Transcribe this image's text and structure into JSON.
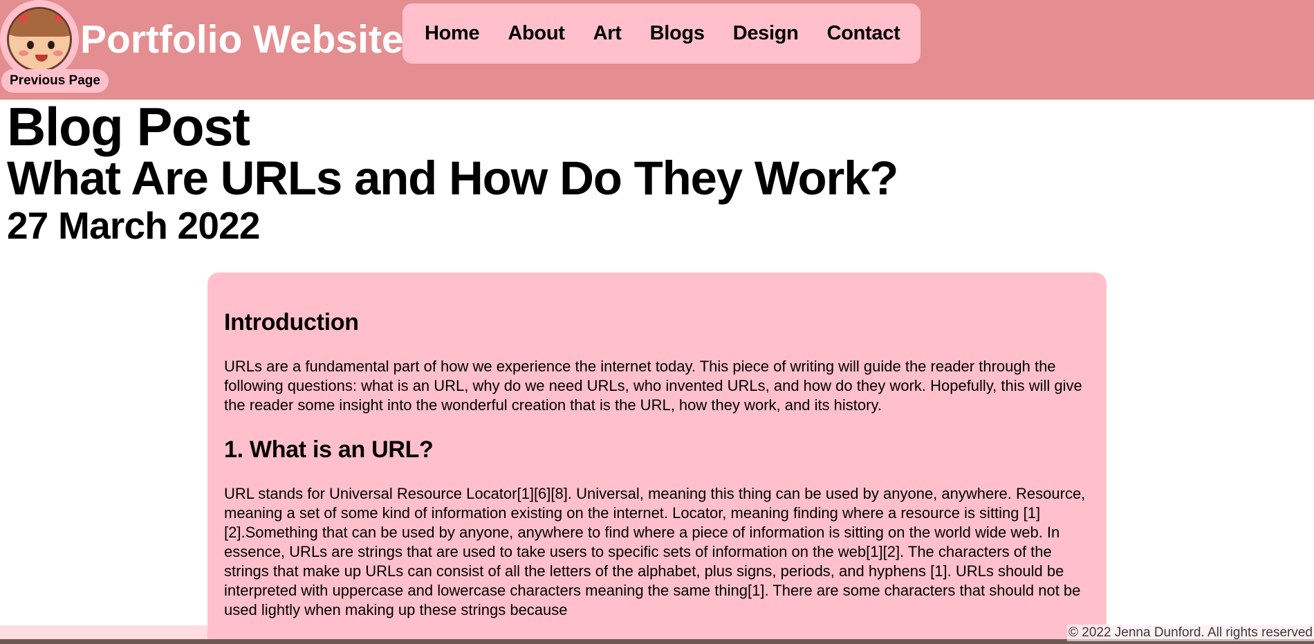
{
  "header": {
    "site_title": "Portfolio Website",
    "nav": [
      "Home",
      "About",
      "Art",
      "Blogs",
      "Design",
      "Contact"
    ],
    "previous_page": "Previous Page"
  },
  "headings": {
    "page_title": "Blog Post",
    "post_title": "What Are URLs and How Do They Work?",
    "date": "27 March 2022"
  },
  "article": {
    "intro_heading": "Introduction",
    "intro_text": "URLs are a fundamental part of how we experience the internet today. This piece of writing will guide the reader through the following questions: what is an URL, why do we need URLs, who invented URLs, and how do they work. Hopefully, this will give the reader some insight into the wonderful creation that is the URL, how they work, and its history.",
    "section1_heading": "1. What is an URL?",
    "section1_text": "URL stands for Universal Resource Locator[1][6][8]. Universal, meaning this thing can be used by anyone, anywhere. Resource, meaning a set of some kind of information existing on the internet. Locator, meaning finding where a resource is sitting [1][2].Something that can be used by anyone, anywhere to find where a piece of information is sitting on the world wide web. In essence, URLs are strings that are used to take users to specific sets of information on the web[1][2]. The characters of the strings that make up URLs can consist of all the letters of the alphabet, plus signs, periods, and hyphens [1]. URLs should be interpreted with uppercase and lowercase characters meaning the same thing[1]. There are some characters that should not be used lightly when making up these strings because"
  },
  "footer": {
    "copyright": "© 2022 Jenna Dunford. All rights reserved"
  }
}
